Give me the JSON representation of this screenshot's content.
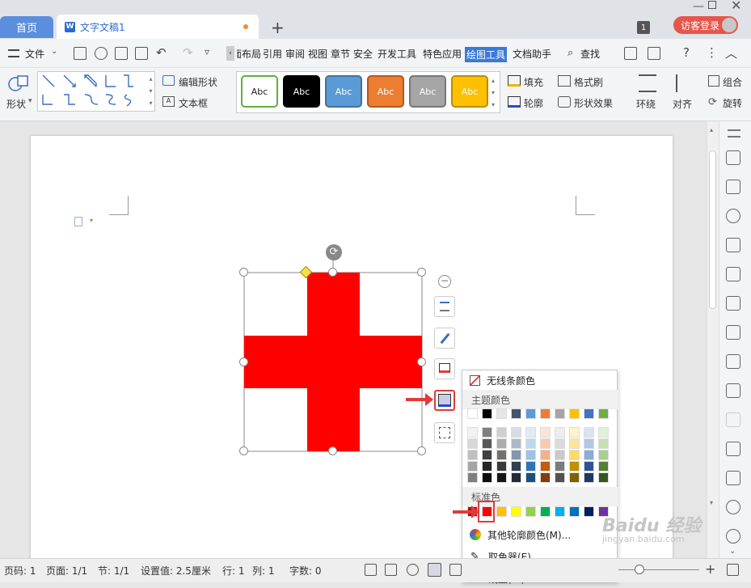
{
  "tabs": {
    "home": "首页",
    "doc": "文字文稿1",
    "add": "+"
  },
  "window": {
    "badge": "1",
    "login": "访客登录"
  },
  "menu": {
    "file": "文件",
    "items": [
      "页面布局",
      "引用",
      "审阅",
      "视图",
      "章节",
      "安全",
      "开发工具",
      "特色应用",
      "绘图工具",
      "文档助手"
    ],
    "search": "查找"
  },
  "ribbon": {
    "shape": "形状",
    "edit_shape": "编辑形状",
    "textbox": "文本框",
    "style_samples": [
      {
        "label": "Abc",
        "bg": "#ffffff",
        "fg": "#222222",
        "border": "#5fb040"
      },
      {
        "label": "Abc",
        "bg": "#000000",
        "fg": "#ffffff",
        "border": "#000000"
      },
      {
        "label": "Abc",
        "bg": "#5b9bd5",
        "fg": "#ffffff",
        "border": "#41719c"
      },
      {
        "label": "Abc",
        "bg": "#ed7d31",
        "fg": "#ffffff",
        "border": "#ae5a21"
      },
      {
        "label": "Abc",
        "bg": "#a5a5a5",
        "fg": "#ffffff",
        "border": "#787878"
      },
      {
        "label": "Abc",
        "bg": "#ffc000",
        "fg": "#ffffff",
        "border": "#bc8c00"
      }
    ],
    "fill": "填充",
    "format_painter": "格式刷",
    "outline": "轮廓",
    "shape_effects": "形状效果",
    "wrap": "环绕",
    "align": "对齐",
    "group": "组合",
    "rotate": "旋转"
  },
  "color_panel": {
    "no_line": "无线条颜色",
    "theme_colors_title": "主题颜色",
    "theme_top": [
      "#ffffff",
      "#000000",
      "#e7e6e6",
      "#44546a",
      "#5b9bd5",
      "#ed7d31",
      "#a5a5a5",
      "#ffc000",
      "#4472c4",
      "#70ad47"
    ],
    "theme_shades": [
      [
        "#f2f2f2",
        "#7f7f7f",
        "#d0cece",
        "#d6dce4",
        "#deebf6",
        "#fbe5d5",
        "#ededed",
        "#fff2cc",
        "#dae3f3",
        "#e2efd9"
      ],
      [
        "#d8d8d8",
        "#595959",
        "#aeabab",
        "#adb9ca",
        "#bdd7ee",
        "#f7cbac",
        "#dbdbdb",
        "#fee599",
        "#b4c6e7",
        "#c5e0b3"
      ],
      [
        "#bfbfbf",
        "#3f3f3f",
        "#757070",
        "#8496b0",
        "#9cc3e5",
        "#f4b183",
        "#c9c9c9",
        "#ffd965",
        "#8eaadb",
        "#a8d08d"
      ],
      [
        "#a5a5a5",
        "#262626",
        "#3a3838",
        "#323f4f",
        "#2e75b5",
        "#c55a11",
        "#7b7b7b",
        "#bf9000",
        "#2f5496",
        "#538135"
      ],
      [
        "#7f7f7f",
        "#0c0c0c",
        "#171616",
        "#222a35",
        "#1e4e79",
        "#833c0b",
        "#525252",
        "#7f6000",
        "#1f3864",
        "#375623"
      ]
    ],
    "standard_title": "标准色",
    "standard": [
      "#c00000",
      "#ff0000",
      "#ffc000",
      "#ffff00",
      "#92d050",
      "#00b050",
      "#00b0f0",
      "#0070c0",
      "#002060",
      "#7030a0"
    ],
    "more": "其他轮廓颜色(M)...",
    "picker": "取色器(E)",
    "line_type": "线型(W)"
  },
  "status": {
    "page_no": "页码: 1",
    "pages": "页面: 1/1",
    "section": "节: 1/1",
    "setting": "设置值: 2.5厘米",
    "row": "行: 1",
    "col": "列: 1",
    "words": "字数: 0"
  },
  "watermark": {
    "brand": "Baidu 经验",
    "url": "jingyan.baidu.com"
  },
  "shape": {
    "fill": "#ff0000"
  }
}
